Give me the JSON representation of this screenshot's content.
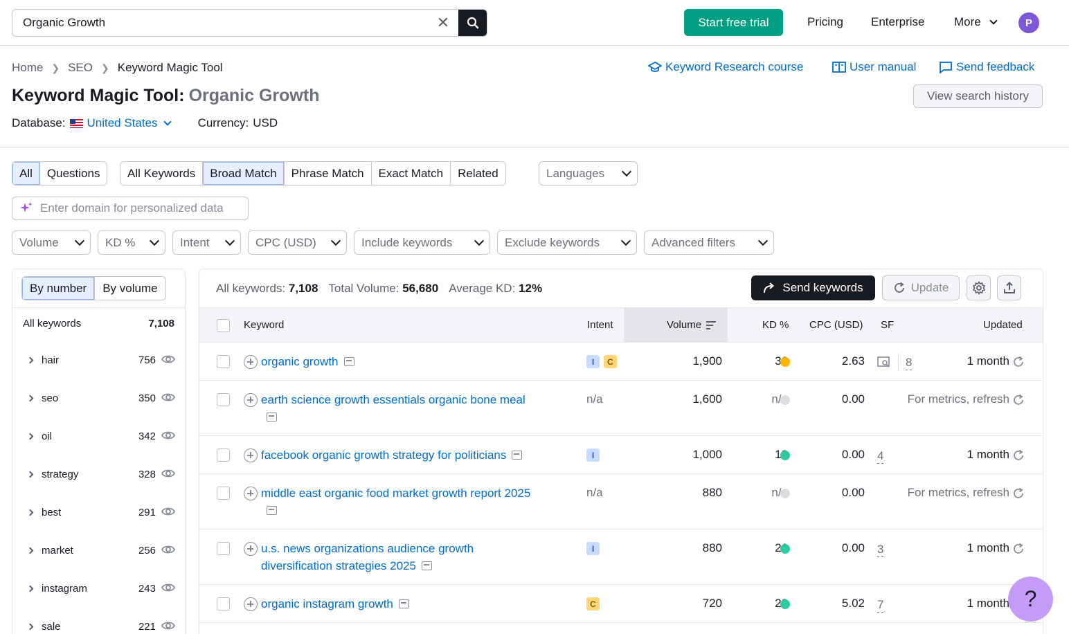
{
  "topbar": {
    "search_value": "Organic Growth",
    "trial_label": "Start free trial",
    "nav": [
      "Pricing",
      "Enterprise",
      "More"
    ],
    "avatar_letter": "P"
  },
  "breadcrumb": [
    "Home",
    "SEO",
    "Keyword Magic Tool"
  ],
  "links": {
    "course": "Keyword Research course",
    "manual": "User manual",
    "feedback": "Send feedback"
  },
  "title": {
    "main": "Keyword Magic Tool:",
    "sub": "Organic Growth"
  },
  "history_label": "View search history",
  "database": {
    "label": "Database:",
    "value": "United States",
    "currency_label": "Currency:",
    "currency": "USD"
  },
  "tabs_type": [
    "All",
    "Questions"
  ],
  "tabs_match": [
    "All Keywords",
    "Broad Match",
    "Phrase Match",
    "Exact Match",
    "Related"
  ],
  "languages_label": "Languages",
  "domain_placeholder": "Enter domain for personalized data",
  "filters": [
    "Volume",
    "KD %",
    "Intent",
    "CPC (USD)",
    "Include keywords",
    "Exclude keywords",
    "Advanced filters"
  ],
  "left": {
    "toggle": [
      "By number",
      "By volume"
    ],
    "all_label": "All keywords",
    "all_count": "7,108",
    "groups": [
      {
        "label": "hair",
        "count": "756"
      },
      {
        "label": "seo",
        "count": "350"
      },
      {
        "label": "oil",
        "count": "342"
      },
      {
        "label": "strategy",
        "count": "328"
      },
      {
        "label": "best",
        "count": "291"
      },
      {
        "label": "market",
        "count": "256"
      },
      {
        "label": "instagram",
        "count": "243"
      },
      {
        "label": "sale",
        "count": "221"
      }
    ]
  },
  "summary": {
    "all_label": "All keywords:",
    "all_value": "7,108",
    "vol_label": "Total Volume:",
    "vol_value": "56,680",
    "kd_label": "Average KD:",
    "kd_value": "12%"
  },
  "actions": {
    "send": "Send keywords",
    "update": "Update"
  },
  "columns": [
    "Keyword",
    "Intent",
    "Volume",
    "KD %",
    "CPC (USD)",
    "SF",
    "Updated"
  ],
  "rows": [
    {
      "kw": "organic growth",
      "intent": [
        "I",
        "C"
      ],
      "volume": "1,900",
      "kd": "36",
      "kd_color": "#ffb400",
      "cpc": "2.63",
      "sf": "8",
      "updated": "1 month"
    },
    {
      "kw": "earth science growth essentials organic bone meal",
      "intent": "n/a",
      "volume": "1,600",
      "kd": "n/a",
      "kd_color": "#dcdde2",
      "cpc": "0.00",
      "sf": "",
      "updated": "For metrics, refresh"
    },
    {
      "kw": "facebook organic growth strategy for politicians",
      "intent": [
        "I"
      ],
      "volume": "1,000",
      "kd": "18",
      "kd_color": "#2ec9a0",
      "cpc": "0.00",
      "sf": "4",
      "updated": "1 month"
    },
    {
      "kw": "middle east organic food market growth report 2025",
      "intent": "n/a",
      "volume": "880",
      "kd": "n/a",
      "kd_color": "#dcdde2",
      "cpc": "0.00",
      "sf": "",
      "updated": "For metrics, refresh"
    },
    {
      "kw": "u.s. news organizations audience growth diversification strategies 2025",
      "intent": [
        "I"
      ],
      "volume": "880",
      "kd": "21",
      "kd_color": "#2ec9a0",
      "cpc": "0.00",
      "sf": "3",
      "updated": "1 month"
    },
    {
      "kw": "organic instagram growth",
      "intent": [
        "C"
      ],
      "volume": "720",
      "kd": "28",
      "kd_color": "#2ec9a0",
      "cpc": "5.02",
      "sf": "7",
      "updated": "1 month"
    }
  ],
  "help_label": "?"
}
